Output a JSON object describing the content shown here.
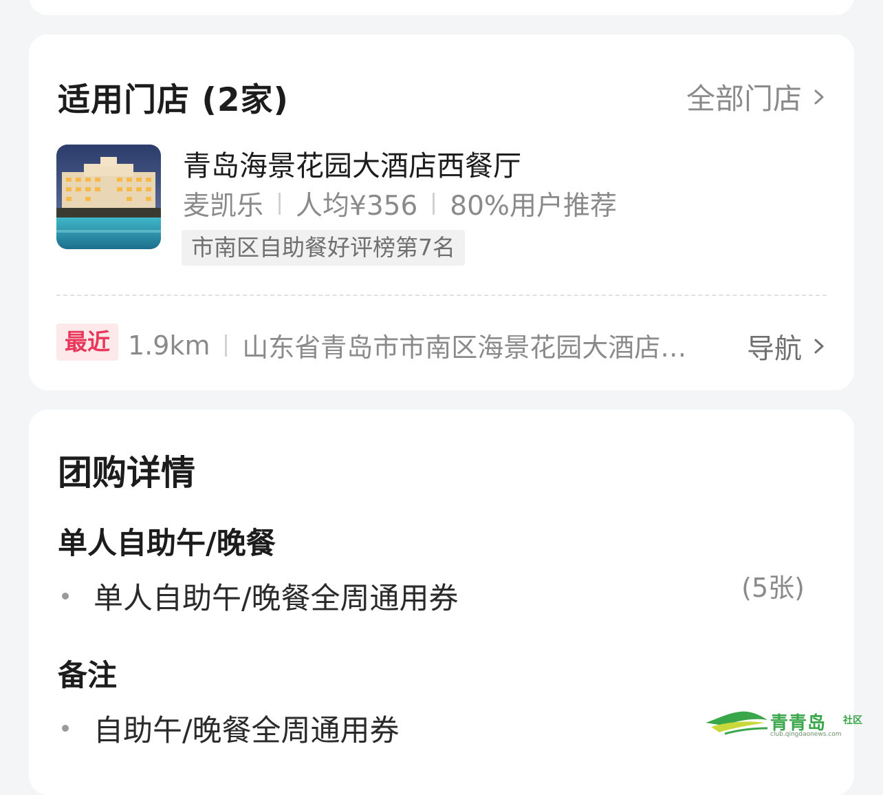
{
  "stores": {
    "title": "适用门店 (2家)",
    "all_link": "全部门店",
    "store_name": "青岛海景花园大酒店西餐厅",
    "cuisine": "麦凯乐",
    "avg_price": "人均¥356",
    "recommend": "80%用户推荐",
    "rank": "市南区自助餐好评榜第7名",
    "nearest_tag": "最近",
    "distance": "1.9km",
    "address": "山东省青岛市市南区海景花园大酒店西餐厅",
    "nav_link": "导航"
  },
  "details": {
    "title": "团购详情",
    "section1_title": "单人自助午/晚餐",
    "item1": "单人自助午/晚餐全周通用券",
    "item1_qty": "(5张)",
    "section2_title": "备注",
    "item2": "自助午/晚餐全周通用券"
  },
  "watermark": {
    "brand": "青青岛",
    "suffix": "社区",
    "url": "club.qingdaonews.com"
  },
  "colors": {
    "accent_red": "#e8375a",
    "nearest_bg": "#fde8ea",
    "watermark_green": "#3aa64a"
  }
}
